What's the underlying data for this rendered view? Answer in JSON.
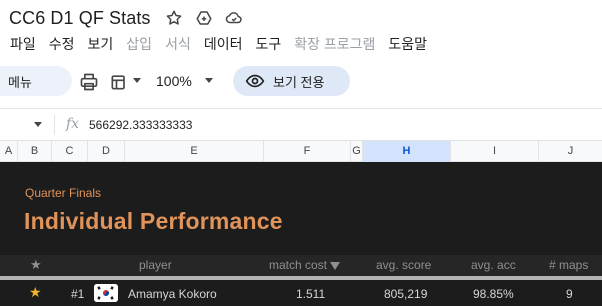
{
  "document": {
    "title": "CC6 D1 QF Stats"
  },
  "title_icons": [
    "star-icon",
    "move-to-drive-icon",
    "cloud-status-icon"
  ],
  "menu": {
    "items": [
      {
        "label": "파일",
        "enabled": true
      },
      {
        "label": "수정",
        "enabled": true
      },
      {
        "label": "보기",
        "enabled": true
      },
      {
        "label": "삽입",
        "enabled": false
      },
      {
        "label": "서식",
        "enabled": false
      },
      {
        "label": "데이터",
        "enabled": true
      },
      {
        "label": "도구",
        "enabled": true
      },
      {
        "label": "확장 프로그램",
        "enabled": false
      },
      {
        "label": "도움말",
        "enabled": true
      }
    ]
  },
  "toolbar": {
    "menu_search_label": "메뉴",
    "zoom": "100%",
    "view_only_label": "보기 전용"
  },
  "formula_bar": {
    "fx_label": "fx",
    "value": "566292.333333333"
  },
  "columns": [
    {
      "label": "A",
      "selected": false
    },
    {
      "label": "B",
      "selected": false
    },
    {
      "label": "C",
      "selected": false
    },
    {
      "label": "D",
      "selected": false
    },
    {
      "label": "E",
      "selected": false
    },
    {
      "label": "F",
      "selected": false
    },
    {
      "label": "G",
      "selected": false
    },
    {
      "label": "H",
      "selected": true
    },
    {
      "label": "I",
      "selected": false
    },
    {
      "label": "J",
      "selected": false
    }
  ],
  "sheet": {
    "subheading": "Quarter Finals",
    "heading": "Individual Performance",
    "accent_color": "#e0935a",
    "background_color": "#1c1c1c",
    "table": {
      "headers": {
        "star": "★",
        "player": "player",
        "match_cost": "match cost",
        "avg_score": "avg. score",
        "avg_acc": "avg. acc",
        "maps": "# maps"
      },
      "sorted_by": "match cost",
      "rows": [
        {
          "star": "★",
          "rank": "#1",
          "flag": "south-korea-flag",
          "player": "Amamya Kokoro",
          "match_cost": "1.511",
          "avg_score": "805,219",
          "avg_acc": "98.85%",
          "maps": "9"
        }
      ]
    }
  }
}
